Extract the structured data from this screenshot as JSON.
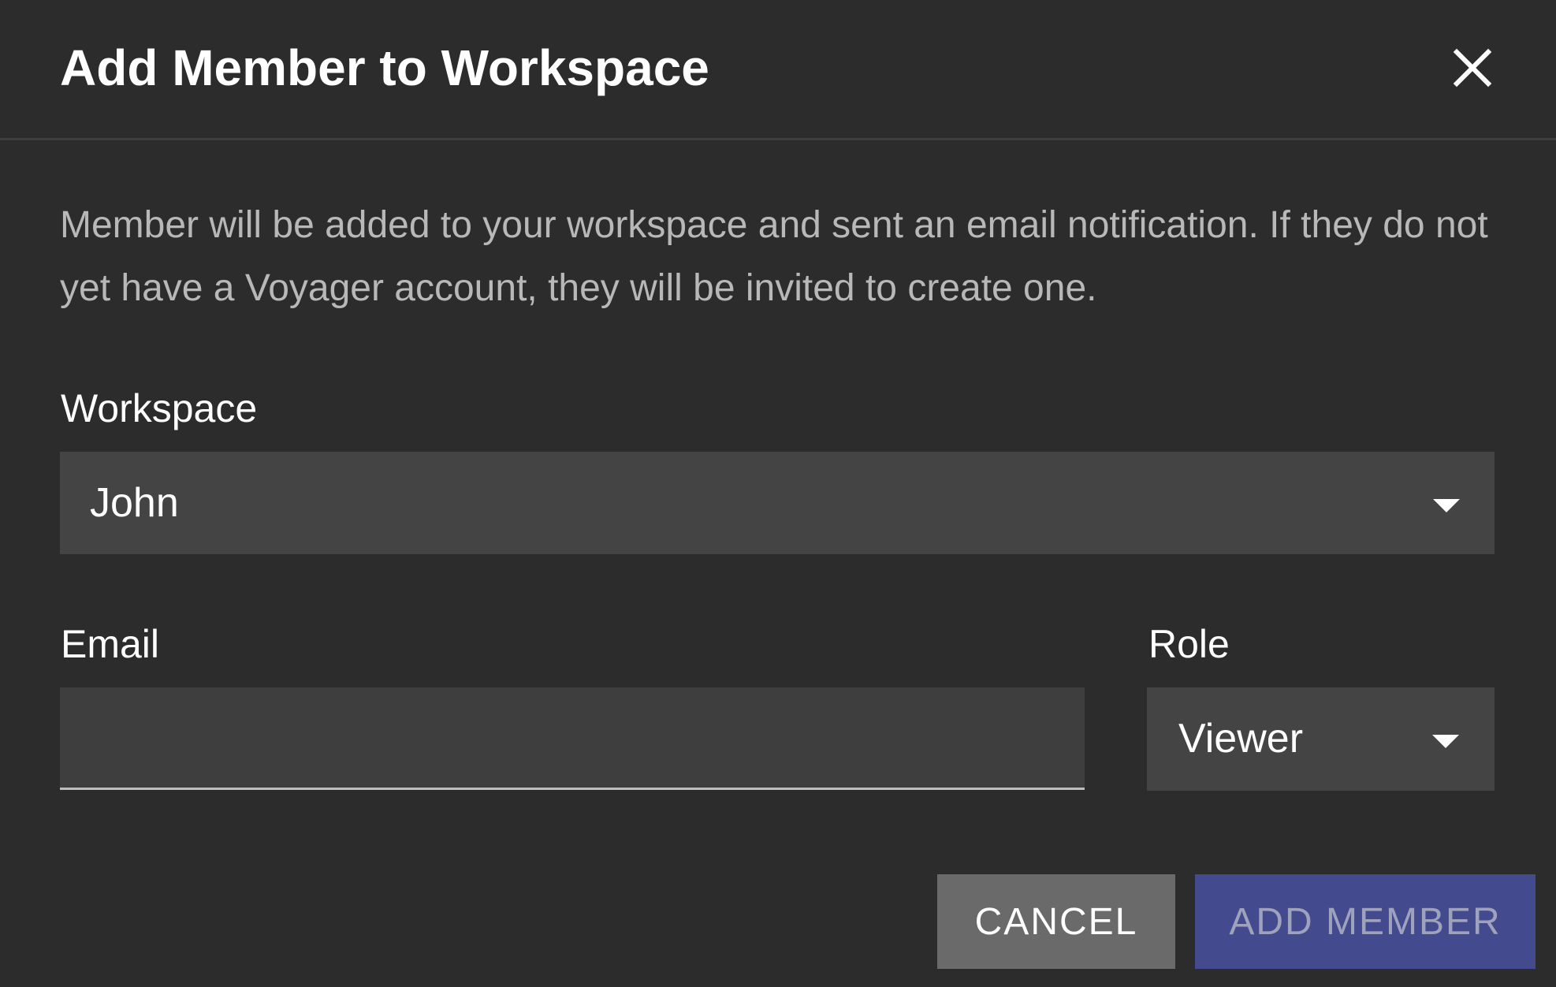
{
  "dialog": {
    "title": "Add Member to Workspace",
    "close_icon": "close-icon",
    "description": "Member will be added to your workspace and sent an email notification. If they do not yet have a Voyager account, they will be invited to create one."
  },
  "workspace": {
    "label": "Workspace",
    "selected": "John",
    "dropdown_icon": "chevron-down-icon"
  },
  "email": {
    "label": "Email",
    "value": "",
    "placeholder": ""
  },
  "role": {
    "label": "Role",
    "selected": "Viewer",
    "dropdown_icon": "chevron-down-icon"
  },
  "actions": {
    "cancel_label": "CANCEL",
    "add_label": "ADD MEMBER",
    "add_enabled": false
  },
  "colors": {
    "background": "#2c2c2c",
    "field_background": "#444444",
    "cancel_background": "#6a6a6a",
    "primary_background": "#434b8e",
    "primary_disabled_text": "#9ea2bd"
  }
}
